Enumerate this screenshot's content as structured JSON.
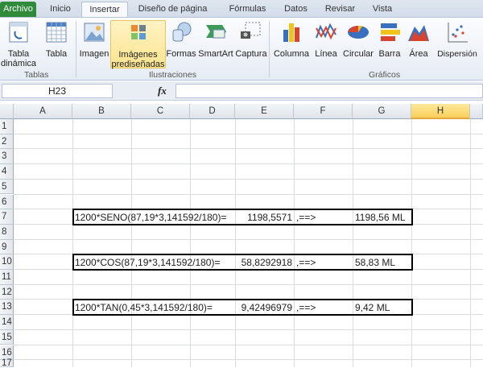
{
  "tabs": [
    "Archivo",
    "Inicio",
    "Insertar",
    "Diseño de página",
    "Fórmulas",
    "Datos",
    "Revisar",
    "Vista"
  ],
  "ribbon": {
    "tablas": {
      "label": "Tablas",
      "items": [
        "Tabla dinámica",
        "Tabla"
      ]
    },
    "ilustraciones": {
      "label": "Ilustraciones",
      "items": [
        "Imagen",
        "Imágenes prediseñadas",
        "Formas",
        "SmartArt",
        "Captura"
      ]
    },
    "graficos": {
      "label": "Gráficos",
      "items": [
        "Columna",
        "Línea",
        "Circular",
        "Barra",
        "Área",
        "Dispersión"
      ]
    }
  },
  "formula_bar": {
    "name_box": "H23",
    "fx": "fx",
    "value": ""
  },
  "columns": [
    "A",
    "B",
    "C",
    "D",
    "E",
    "F",
    "G",
    "H"
  ],
  "selected_column": "H",
  "rows": [
    "1",
    "2",
    "3",
    "4",
    "5",
    "6",
    "7",
    "8",
    "9",
    "10",
    "11",
    "12",
    "13",
    "14",
    "15",
    "16",
    "17"
  ],
  "cells": [
    {
      "row": "7",
      "formula": "1200*SENO(87,19*3,141592/180)=",
      "value": "1198,5571",
      "arrow": ",==>",
      "result": "1198,56 ML"
    },
    {
      "row": "10",
      "formula": "1200*COS(87,19*3,141592/180)=",
      "value": "58,8292918",
      "arrow": ",==>",
      "result": "58,83 ML"
    },
    {
      "row": "13",
      "formula": "1200*TAN(0,45*3,141592/180)=",
      "value": "9,42496979",
      "arrow": ",==>",
      "result": "9,42 ML"
    }
  ]
}
